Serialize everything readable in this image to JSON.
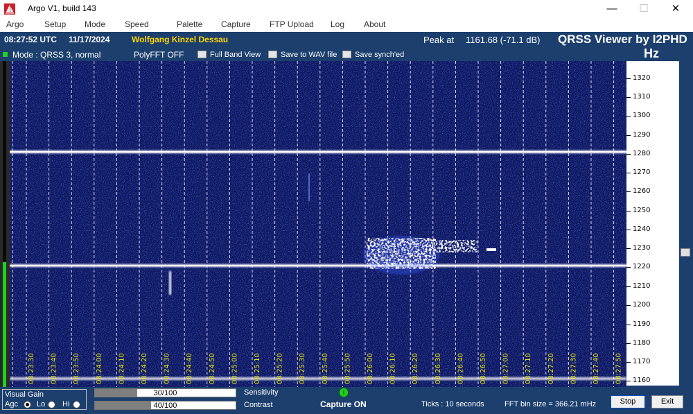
{
  "window": {
    "title": "Argo V1, build 143",
    "controls": {
      "minimize": "—",
      "maximize": "☐",
      "close": "✕"
    }
  },
  "menu": [
    "Argo",
    "Setup",
    "Mode",
    "Speed",
    "Palette",
    "Capture",
    "FTP Upload",
    "Log",
    "About"
  ],
  "info": {
    "time": "08:27:52 UTC",
    "date": "11/17/2024",
    "station": "Wolfgang Kinzel Dessau",
    "peak_label": "Peak at",
    "peak_value": "1161.68 (-71.1 dB)",
    "brand": "QRSS Viewer by I2PHD",
    "units": "Hz",
    "mode": "Mode : QRSS 3, normal",
    "polyfft": "PolyFFT OFF",
    "full_band": "Full Band View",
    "save_wav": "Save to WAV file",
    "save_sync": "Save synch'ed"
  },
  "time_labels": [
    "08:23:30",
    "08:23:40",
    "08:23:50",
    "08:24:00",
    "08:24:10",
    "08:24:20",
    "08:24:30",
    "08:24:40",
    "08:24:50",
    "08:25:00",
    "08:25:10",
    "08:25:20",
    "08:25:30",
    "08:25:40",
    "08:25:50",
    "08:26:00",
    "08:26:10",
    "08:26:20",
    "08:26:30",
    "08:26:40",
    "08:26:50",
    "08:27:00",
    "08:27:10",
    "08:27:20",
    "08:27:30",
    "08:27:40",
    "08:27:50"
  ],
  "freq_labels": [
    "1320",
    "1310",
    "1300",
    "1290",
    "1280",
    "1270",
    "1260",
    "1250",
    "1240",
    "1230",
    "1220",
    "1210",
    "1200",
    "1190",
    "1180",
    "1170",
    "1160"
  ],
  "bottom": {
    "visual_gain": "Visual Gain",
    "agc": "Agc",
    "lo": "Lo",
    "hi": "Hi",
    "sensitivity_value": "30/100",
    "sensitivity_fraction": 0.3,
    "sensitivity_label": "Sensitivity",
    "contrast_value": "40/100",
    "contrast_fraction": 0.4,
    "contrast_label": "Contrast",
    "capture_status": "Capture ON",
    "capture_led": "i",
    "ticks": "Ticks  : 10 seconds",
    "fft_bin": "FFT bin size = 366.21 mHz",
    "stop": "Stop",
    "exit": "Exit"
  },
  "colors": {
    "background": "#1c3f6e",
    "spectrogram": "#0b1660",
    "signal": "#ffffff",
    "time_label": "#e8e800",
    "station": "#ffd700",
    "led": "#20d020"
  }
}
